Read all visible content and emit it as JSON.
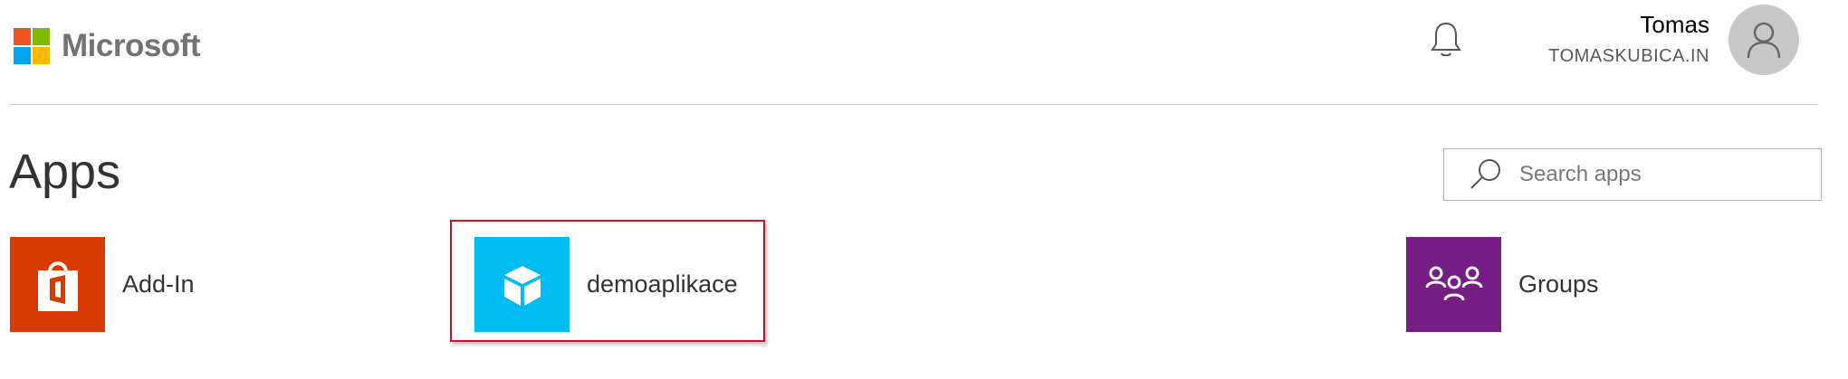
{
  "header": {
    "brand": "Microsoft",
    "brand_colors": [
      "#f25022",
      "#7fba00",
      "#00a4ef",
      "#ffb900"
    ],
    "notifications_icon": "bell-icon",
    "user": {
      "name": "Tomas",
      "org": "TOMASKUBICA.IN",
      "avatar_icon": "person-icon"
    }
  },
  "main": {
    "title": "Apps",
    "search": {
      "placeholder": "Search apps",
      "value": "",
      "icon": "search-icon"
    },
    "apps": [
      {
        "label": "Add-In",
        "color": "#d83b01",
        "icon": "office-store-icon"
      },
      {
        "label": "demoaplikace",
        "color": "#00bcf2",
        "icon": "cube-icon",
        "highlighted": true
      },
      {
        "label": "Groups",
        "color": "#761c85",
        "icon": "groups-icon"
      }
    ],
    "highlight_color": "#d0101a"
  }
}
